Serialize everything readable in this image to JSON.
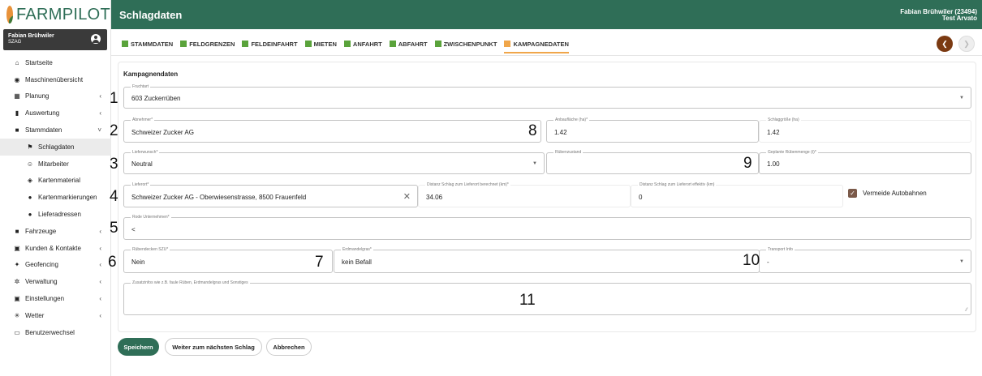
{
  "app": {
    "logo_text": "FARMPILOT",
    "title": "Schlagdaten"
  },
  "user": {
    "name": "Fabian Brühwiler",
    "org": "SZAG",
    "topbar_name": "Fabian Brühwiler (23494)",
    "topbar_sub": "Test Arvato"
  },
  "nav": [
    {
      "label": "Startseite",
      "icon": "home-icon",
      "glyph": "⌂",
      "chevron": ""
    },
    {
      "label": "Maschinenübersicht",
      "icon": "gauge-icon",
      "glyph": "◉",
      "chevron": ""
    },
    {
      "label": "Planung",
      "icon": "calendar-icon",
      "glyph": "▦",
      "chevron": "‹"
    },
    {
      "label": "Auswertung",
      "icon": "bar-chart-icon",
      "glyph": "▮",
      "chevron": "‹"
    },
    {
      "label": "Stammdaten",
      "icon": "folder-icon",
      "glyph": "■",
      "chevron": "˅",
      "active": true
    },
    {
      "label": "Schlagdaten",
      "icon": "flag-icon",
      "glyph": "⚑",
      "chevron": "",
      "sub": true,
      "active": true
    },
    {
      "label": "Mitarbeiter",
      "icon": "people-icon",
      "glyph": "☺",
      "chevron": "",
      "sub": true
    },
    {
      "label": "Kartenmaterial",
      "icon": "layers-icon",
      "glyph": "◈",
      "chevron": "",
      "sub": true
    },
    {
      "label": "Kartenmarkierungen",
      "icon": "map-pin-icon",
      "glyph": "●",
      "chevron": "",
      "sub": true
    },
    {
      "label": "Lieferadressen",
      "icon": "location-icon",
      "glyph": "●",
      "chevron": "",
      "sub": true
    },
    {
      "label": "Fahrzeuge",
      "icon": "truck-icon",
      "glyph": "■",
      "chevron": "‹"
    },
    {
      "label": "Kunden & Kontakte",
      "icon": "contact-card-icon",
      "glyph": "▣",
      "chevron": "‹"
    },
    {
      "label": "Geofencing",
      "icon": "geofence-icon",
      "glyph": "✦",
      "chevron": "‹"
    },
    {
      "label": "Verwaltung",
      "icon": "gear-icon",
      "glyph": "✲",
      "chevron": "‹"
    },
    {
      "label": "Einstellungen",
      "icon": "settings-panel-icon",
      "glyph": "▣",
      "chevron": "‹"
    },
    {
      "label": "Wetter",
      "icon": "weather-icon",
      "glyph": "✳",
      "chevron": "‹"
    },
    {
      "label": "Benutzerwechsel",
      "icon": "laptop-icon",
      "glyph": "▭",
      "chevron": ""
    }
  ],
  "tabs": [
    "STAMMDATEN",
    "FELDGRENZEN",
    "FELDEINFAHRT",
    "MIETEN",
    "ANFAHRT",
    "ABFAHRT",
    "ZWISCHENPUNKT",
    "KAMPAGNEDATEN"
  ],
  "active_tab": "KAMPAGNEDATEN",
  "section_title": "Kampagnendaten",
  "fields": {
    "fruchtart": {
      "label": "Fruchtart",
      "value": "603 Zuckerrüben"
    },
    "abnehmer": {
      "label": "Abnehmer*",
      "value": "Schweizer Zucker AG"
    },
    "anbauflaeche": {
      "label": "Anbaufläche (ha)*",
      "value": "1.42"
    },
    "schlaggroesse": {
      "label": "Schlaggröße (ha)",
      "value": "1.42"
    },
    "lieferwunsch": {
      "label": "Lieferwunsch*",
      "value": "Neutral"
    },
    "ruebenzustand": {
      "label": "Rübenzustand",
      "value": ""
    },
    "geplante_menge": {
      "label": "Geplante Rübenmenge (t)*",
      "value": "1.00"
    },
    "lieferort": {
      "label": "Lieferort*",
      "value": "Schweizer Zucker AG - Oberwiesenstrasse, 8500 Frauenfeld"
    },
    "distanz_berechnet": {
      "label": "Distanz Schlag zum Lieferort berechnet (km)*",
      "value": "34.06"
    },
    "distanz_effektiv": {
      "label": "Distanz Schlag zum Lieferort effektiv (km)",
      "value": "0"
    },
    "vermeide_autobahnen": {
      "label": "Vermeide Autobahnen",
      "checked": true
    },
    "rode_unternehmen": {
      "label": "Rode Unternehmen*",
      "value": "<"
    },
    "ruebendecken": {
      "label": "Rübendecken SZU*",
      "value": "Nein"
    },
    "erdmandelgras": {
      "label": "Erdmandelgras*",
      "value": "kein Befall"
    },
    "transport_info": {
      "label": "Transport Info",
      "value": "-"
    },
    "zusatzinfos": {
      "label": "Zusatzinfos wie z.B. faule Rüben, Erdmandelgras und Sonstiges",
      "value": ""
    }
  },
  "annotations": [
    "1",
    "2",
    "3",
    "4",
    "5",
    "6",
    "7",
    "8",
    "9",
    "10",
    "11"
  ],
  "buttons": {
    "save": "Speichern",
    "next_field": "Weiter zum nächsten Schlag",
    "cancel": "Abbrechen"
  }
}
